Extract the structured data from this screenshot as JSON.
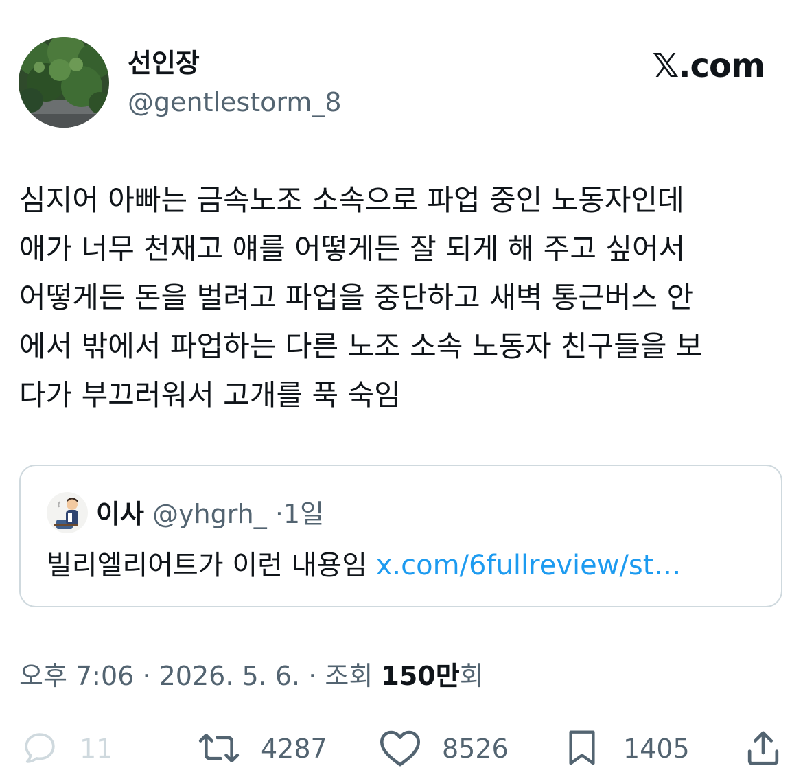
{
  "tweet": {
    "display_name": "선인장",
    "handle": "@gentlestorm_8",
    "brand": "𝕏.com",
    "text": "심지어 아빠는 금속노조 소속으로 파업 중인 노동자인데\n애가 너무 천재고 얘를 어떻게든 잘 되게 해 주고 싶어서\n어떻게든 돈을 벌려고 파업을 중단하고 새벽 통근버스 안\n에서 밖에서 파업하는 다른 노조 소속 노동자 친구들을 보\n다가 부끄러워서 고개를 푹 숙임"
  },
  "quote": {
    "name": "이사",
    "handle": "@yhgrh_",
    "age": "·1일",
    "text": "빌리엘리어트가 이런 내용임",
    "link": "x.com/6fullreview/st…"
  },
  "meta": {
    "time": "오후 7:06",
    "date": "2026. 5. 6.",
    "views_label": "조회",
    "views_count": "150만",
    "views_suffix": "회"
  },
  "actions": {
    "replies": "11",
    "reposts": "4287",
    "likes": "8526",
    "bookmarks": "1405"
  },
  "colors": {
    "text_primary": "#0f1419",
    "text_secondary": "#536471",
    "link": "#1d9bf0",
    "border": "#cfd9de"
  },
  "icons": {
    "avatar": "ivy-wall-avatar",
    "quote_avatar": "cartoon-person-avatar",
    "reply": "reply-icon",
    "repost": "repost-icon",
    "like": "heart-icon",
    "bookmark": "bookmark-icon",
    "share": "share-icon"
  }
}
